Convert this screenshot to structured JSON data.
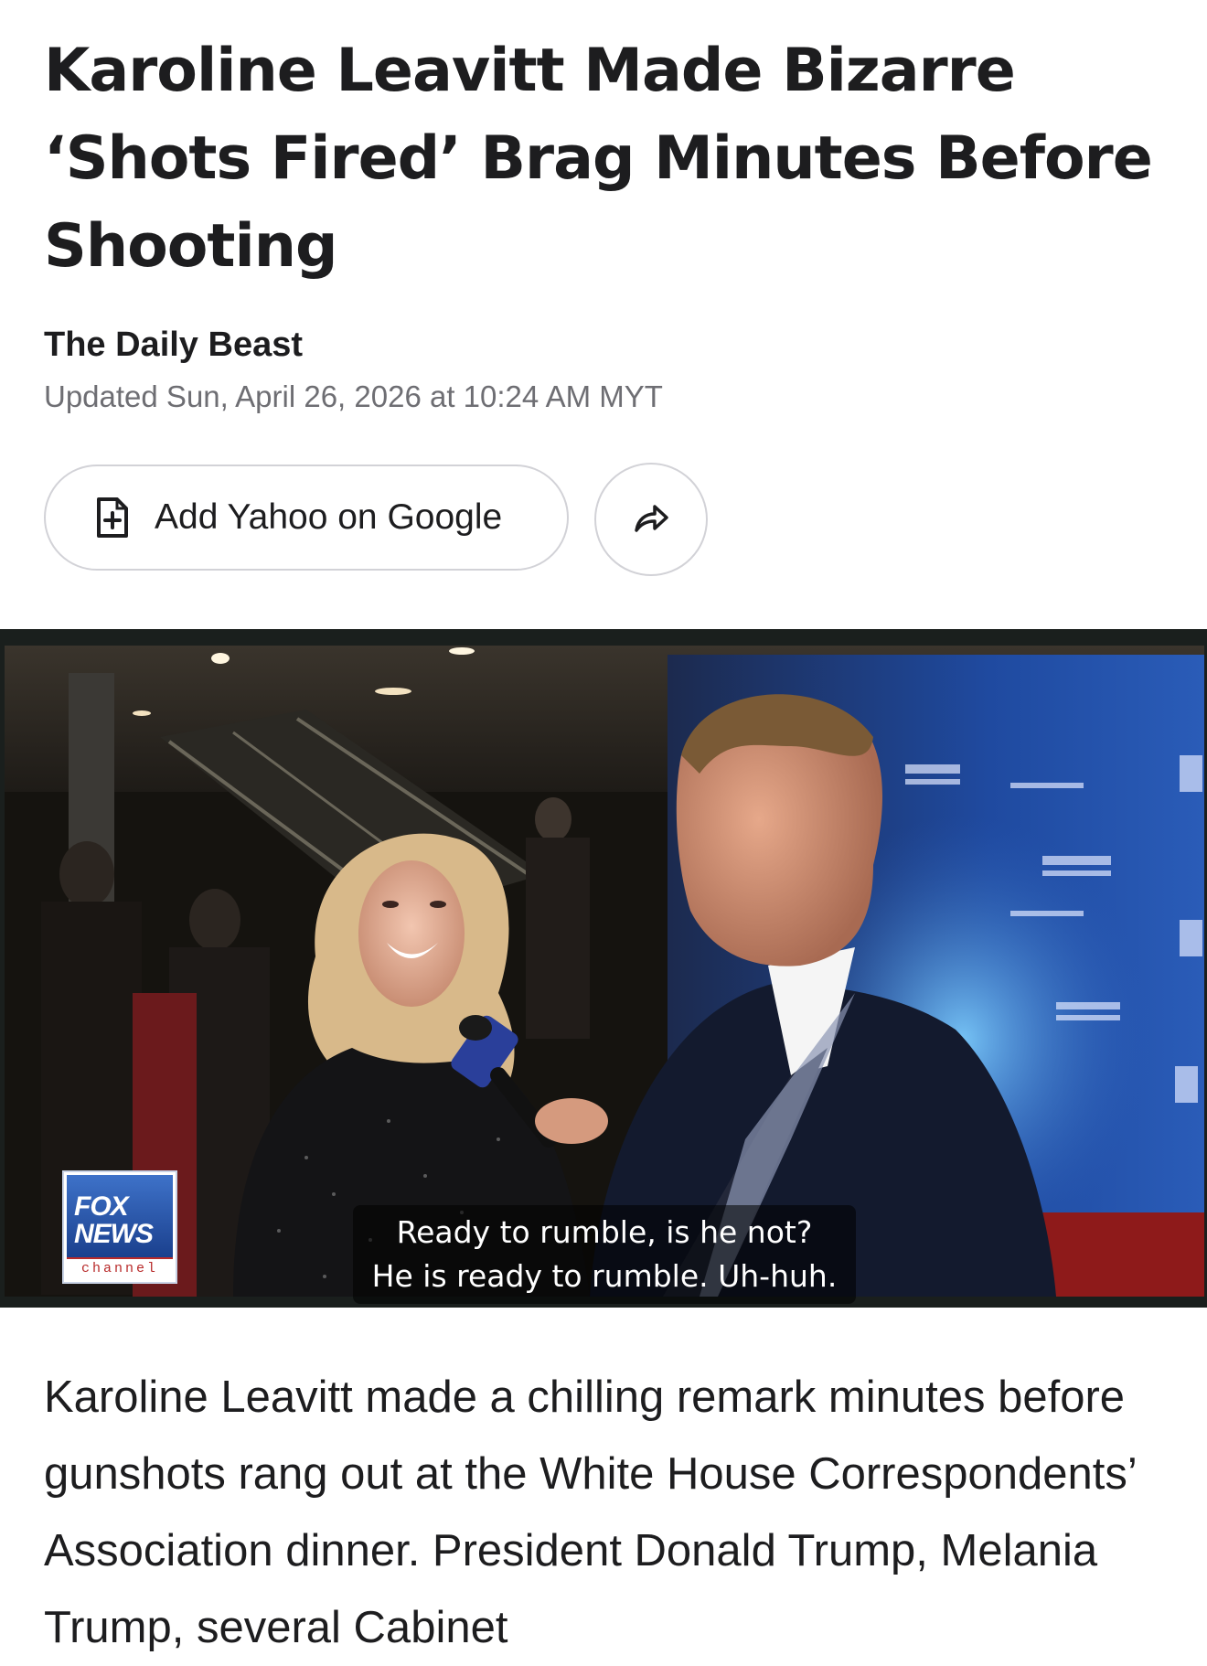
{
  "article": {
    "title": "Karoline Leavitt Made Bizarre ‘Shots Fired’ Brag Minutes Before Shooting",
    "source": "The Daily Beast",
    "timestamp": "Updated Sun, April 26, 2026 at 10:24 AM MYT",
    "body": "Karoline Leavitt made a chilling remark minutes before gunshots rang out at the White House Correspondents’ Association dinner. President Donald Trump, Melania Trump, several Cabinet"
  },
  "actions": {
    "add_yahoo_label": "Add Yahoo on Google",
    "add_icon": "doc-plus-icon",
    "share_icon": "share-arrow-icon"
  },
  "video": {
    "logo": {
      "line1": "FOX",
      "line2": "NEWS",
      "line3": "channel"
    },
    "caption": {
      "line1": "Ready to rumble, is he not?",
      "line2": "He is ready to rumble. Uh-huh."
    }
  }
}
